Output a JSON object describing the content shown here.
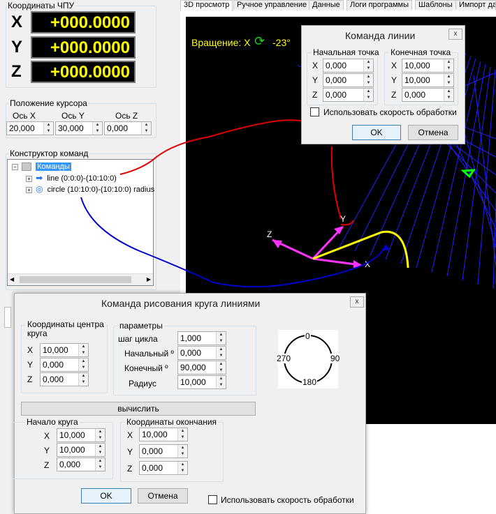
{
  "left_panel": {
    "cnc_coords": {
      "title": "Координаты ЧПУ",
      "axes": [
        {
          "letter": "X",
          "value": "+000.0000"
        },
        {
          "letter": "Y",
          "value": "+000.0000"
        },
        {
          "letter": "Z",
          "value": "+000.0000"
        }
      ]
    },
    "cursor_position": {
      "title": "Положение курсора",
      "labels": [
        "Ось X",
        "Ось Y",
        "Ось Z"
      ],
      "values": [
        "20,000",
        "30,000",
        "0,000"
      ]
    },
    "command_builder": {
      "title": "Конструктор команд",
      "root": "Команды",
      "items": [
        "line (0:0:0)-(10:10:0)",
        "circle (10:10:0)-(10:10:0) radius"
      ]
    }
  },
  "tabs": [
    "3D просмотр",
    "Ручное управление",
    "Данные",
    "Логи программы",
    "Шаблоны",
    "Импорт да"
  ],
  "viewport": {
    "rotation_label": "Вращение: X",
    "rotation_value": "-23°",
    "axis_labels": {
      "x": "X",
      "y": "Y",
      "z": "Z"
    },
    "colors": {
      "background": "#000000",
      "grid": "#1c1cff",
      "x_axis": "#ff33ff",
      "arc": "#ffff00",
      "annotation": "#e00000",
      "annotation2": "#0000cc",
      "marker": "#00ff00"
    }
  },
  "line_dialog": {
    "title": "Команда линии",
    "start_group": "Начальная точка",
    "end_group": "Конечная точка",
    "start": [
      {
        "axis": "X",
        "value": "0,000"
      },
      {
        "axis": "Y",
        "value": "0,000"
      },
      {
        "axis": "Z",
        "value": "0,000"
      }
    ],
    "end": [
      {
        "axis": "X",
        "value": "10,000"
      },
      {
        "axis": "Y",
        "value": "10,000"
      },
      {
        "axis": "Z",
        "value": "0,000"
      }
    ],
    "speed_checkbox": "Использовать скорость обработки",
    "ok": "OK",
    "cancel": "Отмена",
    "close": "x"
  },
  "circle_dialog": {
    "title": "Команда рисования круга линиями",
    "center_group": "Координаты центра круга",
    "center": [
      {
        "axis": "X",
        "value": "10,000"
      },
      {
        "axis": "Y",
        "value": "0,000"
      },
      {
        "axis": "Z",
        "value": "0,000"
      }
    ],
    "params_group": "параметры",
    "params": [
      {
        "label": "шаг цикла",
        "value": "1,000"
      },
      {
        "label": "Начальный º",
        "value": "0,000"
      },
      {
        "label": "Конечный º",
        "value": "90,000"
      },
      {
        "label": "Радиус",
        "value": "10,000"
      }
    ],
    "dial_labels": {
      "top": "0",
      "right": "90",
      "bottom": "180",
      "left": "270"
    },
    "compute": "вычислить",
    "start_group": "Начало круга",
    "start": [
      {
        "axis": "X",
        "value": "10,000"
      },
      {
        "axis": "Y",
        "value": "10,000"
      },
      {
        "axis": "Z",
        "value": "0,000"
      }
    ],
    "end_group": "Координаты окончания",
    "end": [
      {
        "axis": "X",
        "value": "10,000"
      },
      {
        "axis": "Y",
        "value": "0,000"
      },
      {
        "axis": "Z",
        "value": "0,000"
      }
    ],
    "ok": "OK",
    "cancel": "Отмена",
    "speed_checkbox": "Использовать скорость обработки",
    "close": "x"
  }
}
